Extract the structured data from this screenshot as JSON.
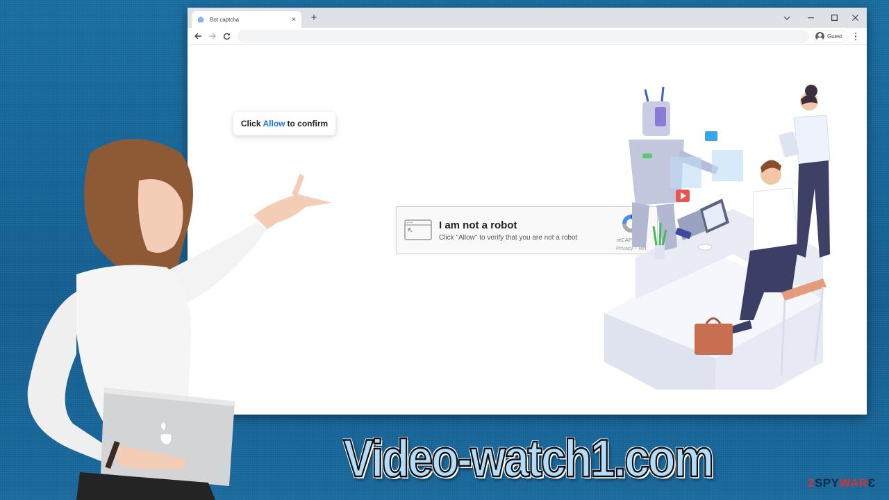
{
  "browser": {
    "tab": {
      "title": "Bot captcha",
      "favicon": "robot-favicon",
      "close_icon": "×"
    },
    "new_tab_icon": "+",
    "window_controls": {
      "dropdown": "⌄",
      "minimize": "–",
      "maximize": "☐",
      "close": "✕"
    },
    "nav": {
      "back": "←",
      "forward": "→",
      "reload": "⟳"
    },
    "address_bar": {
      "value": "",
      "placeholder": ""
    },
    "profile": {
      "label": "Guest"
    }
  },
  "page": {
    "allow_prompt": {
      "prefix": "Click",
      "highlight": "Allow",
      "suffix": "to confirm",
      "highlight_color": "#1a73e8"
    },
    "captcha": {
      "headline": "I am not a robot",
      "subtext": "Click \"Allow\" to verify that you are not a robot",
      "brand": "reCAPTCHA",
      "links": "Privacy - Terr"
    }
  },
  "overlay": {
    "title": "Video-watch1.com",
    "watermark": {
      "n": "2",
      "spy": "SPY",
      "ware": "WAR",
      "tail": "Ɛ"
    }
  },
  "colors": {
    "background": "#16679a",
    "accent_blue": "#1a73e8",
    "title_fill": "#b3dcfa",
    "watermark_red": "#d8312f"
  }
}
